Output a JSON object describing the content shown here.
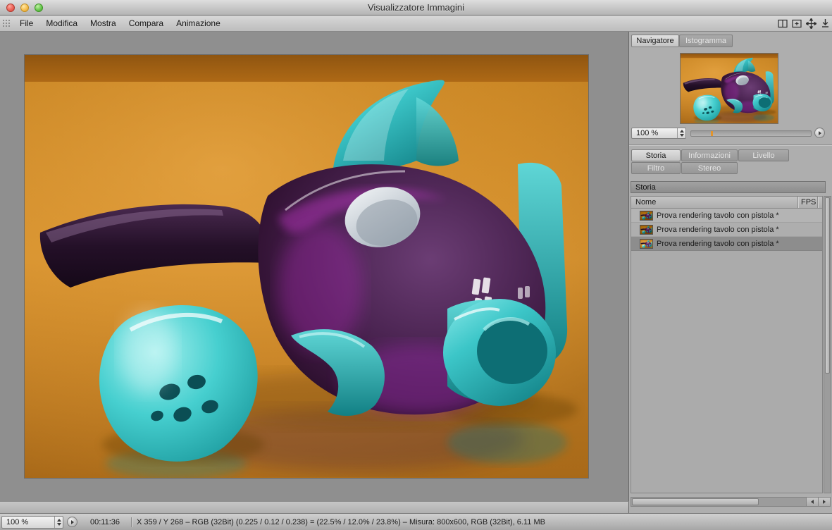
{
  "window": {
    "title": "Visualizzatore Immagini"
  },
  "menubar": {
    "items": [
      {
        "label": "File"
      },
      {
        "label": "Modifica"
      },
      {
        "label": "Mostra"
      },
      {
        "label": "Compara"
      },
      {
        "label": "Animazione"
      }
    ]
  },
  "navigator": {
    "tab_navigatore": "Navigatore",
    "tab_istogramma": "Istogramma",
    "zoom": "100 %"
  },
  "panel_tabs": {
    "storia": "Storia",
    "informazioni": "Informazioni",
    "livello": "Livello",
    "filtro": "Filtro",
    "stereo": "Stereo"
  },
  "history": {
    "title": "Storia",
    "columns": {
      "name": "Nome",
      "fps": "FPS"
    },
    "rows": [
      {
        "name": "Prova rendering tavolo con pistola *"
      },
      {
        "name": "Prova rendering tavolo con pistola *"
      },
      {
        "name": "Prova rendering tavolo con pistola *"
      }
    ]
  },
  "statusbar": {
    "zoom": "100 %",
    "time": "00:11:36",
    "info": "X 359 / Y 268 – RGB (32Bit) (0.225 / 0.12 / 0.238) = (22.5% / 12.0% / 23.8%) – Misura: 800x600, RGB (32Bit), 6.11 MB"
  },
  "colors": {
    "table_orange": "#cf8a28",
    "part_teal": "#3cc6c8",
    "body_purple": "#4c2553",
    "selection_gray": "#8d8d8d"
  }
}
